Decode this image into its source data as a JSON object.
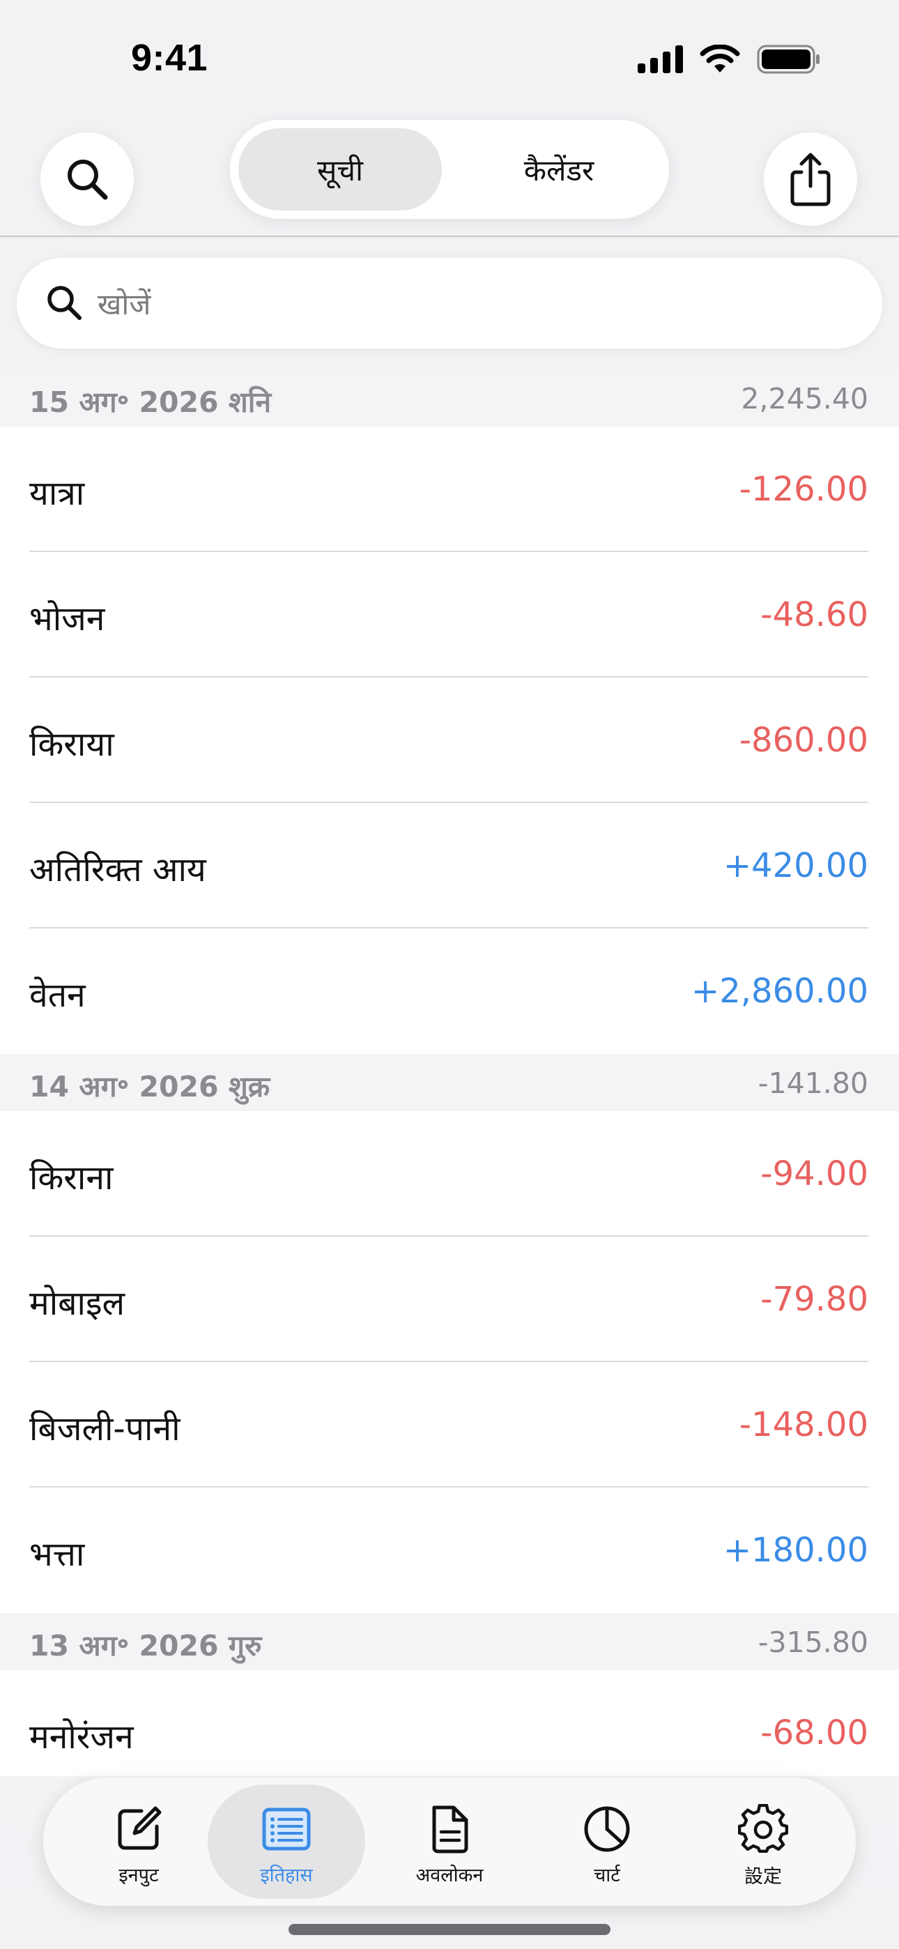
{
  "status_bar": {
    "time": "9:41",
    "icons": [
      "cellular-signal-icon",
      "wifi-icon",
      "battery-icon"
    ]
  },
  "top_nav": {
    "search_icon": "search-icon",
    "segments": [
      {
        "label": "सूची",
        "selected": true
      },
      {
        "label": "कैलेंडर",
        "selected": false
      }
    ],
    "share_icon": "share-icon"
  },
  "search": {
    "placeholder": "खोजें",
    "value": ""
  },
  "colors": {
    "expense": "#e8615f",
    "income": "#3b8ce6",
    "accent": "#3b8ce6",
    "section_text": "#8b8b8f"
  },
  "sections": [
    {
      "date": "15 अग॰ 2026 शनि",
      "total": "2,245.40",
      "items": [
        {
          "category": "यात्रा",
          "amount": "-126.00",
          "kind": "neg"
        },
        {
          "category": "भोजन",
          "amount": "-48.60",
          "kind": "neg"
        },
        {
          "category": "किराया",
          "amount": "-860.00",
          "kind": "neg"
        },
        {
          "category": "अतिरिक्त आय",
          "amount": "+420.00",
          "kind": "pos"
        },
        {
          "category": "वेतन",
          "amount": "+2,860.00",
          "kind": "pos"
        }
      ]
    },
    {
      "date": "14 अग॰ 2026 शुक्र",
      "total": "-141.80",
      "items": [
        {
          "category": "किराना",
          "amount": "-94.00",
          "kind": "neg"
        },
        {
          "category": "मोबाइल",
          "amount": "-79.80",
          "kind": "neg"
        },
        {
          "category": "बिजली-पानी",
          "amount": "-148.00",
          "kind": "neg"
        },
        {
          "category": "भत्ता",
          "amount": "+180.00",
          "kind": "pos"
        }
      ]
    },
    {
      "date": "13 अग॰ 2026 गुरु",
      "total": "-315.80",
      "items": [
        {
          "category": "मनोरंजन",
          "amount": "-68.00",
          "kind": "neg"
        }
      ]
    }
  ],
  "tab_bar": {
    "tabs": [
      {
        "label": "इनपुट",
        "icon": "compose-icon",
        "selected": false
      },
      {
        "label": "इतिहास",
        "icon": "list-icon",
        "selected": true
      },
      {
        "label": "अवलोकन",
        "icon": "document-icon",
        "selected": false
      },
      {
        "label": "चार्ट",
        "icon": "pie-chart-icon",
        "selected": false
      },
      {
        "label": "設定",
        "icon": "gear-icon",
        "selected": false
      }
    ]
  }
}
